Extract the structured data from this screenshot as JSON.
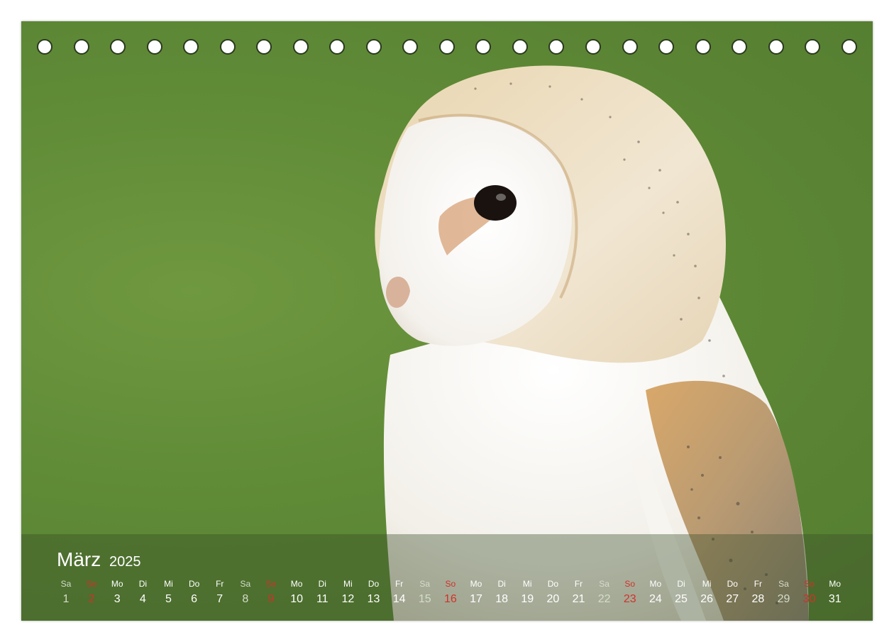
{
  "calendar": {
    "month": "März",
    "year": "2025",
    "days": [
      {
        "wd": "Sa",
        "n": "1",
        "type": "sat"
      },
      {
        "wd": "So",
        "n": "2",
        "type": "sun"
      },
      {
        "wd": "Mo",
        "n": "3",
        "type": "wk"
      },
      {
        "wd": "Di",
        "n": "4",
        "type": "wk"
      },
      {
        "wd": "Mi",
        "n": "5",
        "type": "wk"
      },
      {
        "wd": "Do",
        "n": "6",
        "type": "wk"
      },
      {
        "wd": "Fr",
        "n": "7",
        "type": "wk"
      },
      {
        "wd": "Sa",
        "n": "8",
        "type": "sat"
      },
      {
        "wd": "So",
        "n": "9",
        "type": "sun"
      },
      {
        "wd": "Mo",
        "n": "10",
        "type": "wk"
      },
      {
        "wd": "Di",
        "n": "11",
        "type": "wk"
      },
      {
        "wd": "Mi",
        "n": "12",
        "type": "wk"
      },
      {
        "wd": "Do",
        "n": "13",
        "type": "wk"
      },
      {
        "wd": "Fr",
        "n": "14",
        "type": "wk"
      },
      {
        "wd": "Sa",
        "n": "15",
        "type": "sat"
      },
      {
        "wd": "So",
        "n": "16",
        "type": "sun"
      },
      {
        "wd": "Mo",
        "n": "17",
        "type": "wk"
      },
      {
        "wd": "Di",
        "n": "18",
        "type": "wk"
      },
      {
        "wd": "Mi",
        "n": "19",
        "type": "wk"
      },
      {
        "wd": "Do",
        "n": "20",
        "type": "wk"
      },
      {
        "wd": "Fr",
        "n": "21",
        "type": "wk"
      },
      {
        "wd": "Sa",
        "n": "22",
        "type": "sat"
      },
      {
        "wd": "So",
        "n": "23",
        "type": "sun"
      },
      {
        "wd": "Mo",
        "n": "24",
        "type": "wk"
      },
      {
        "wd": "Di",
        "n": "25",
        "type": "wk"
      },
      {
        "wd": "Mi",
        "n": "26",
        "type": "wk"
      },
      {
        "wd": "Do",
        "n": "27",
        "type": "wk"
      },
      {
        "wd": "Fr",
        "n": "28",
        "type": "wk"
      },
      {
        "wd": "Sa",
        "n": "29",
        "type": "sat"
      },
      {
        "wd": "So",
        "n": "30",
        "type": "sun"
      },
      {
        "wd": "Mo",
        "n": "31",
        "type": "wk"
      }
    ]
  },
  "binding": {
    "hole_count": 23
  },
  "colors": {
    "background_green": "#5f8a36",
    "sunday_red": "#d0322a",
    "text_white": "#ffffff"
  }
}
